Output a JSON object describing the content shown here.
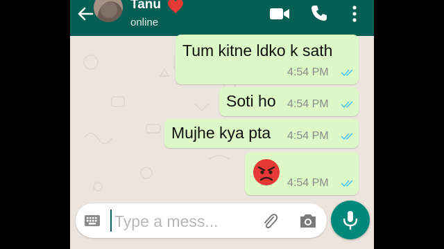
{
  "header": {
    "contact_name": "Tanu",
    "status": "online",
    "heart_emoji": "red-heart-icon",
    "bar_color": "#075e54"
  },
  "messages": [
    {
      "text": "Tum kitne ldko k sath",
      "time": "4:54 PM",
      "status": "read"
    },
    {
      "text": "Soti ho",
      "time": "4:54 PM",
      "status": "read"
    },
    {
      "text": "Mujhe kya pta",
      "time": "4:54 PM",
      "status": "read"
    },
    {
      "emoji": "angry-face-icon",
      "time": "4:54 PM",
      "status": "read"
    }
  ],
  "composer": {
    "placeholder": "Type a mess...",
    "mic_color": "#00897b"
  },
  "colors": {
    "outgoing_bubble": "#dcf8c6",
    "chat_background": "#ece5dd",
    "read_ticks": "#4fc3f7"
  }
}
